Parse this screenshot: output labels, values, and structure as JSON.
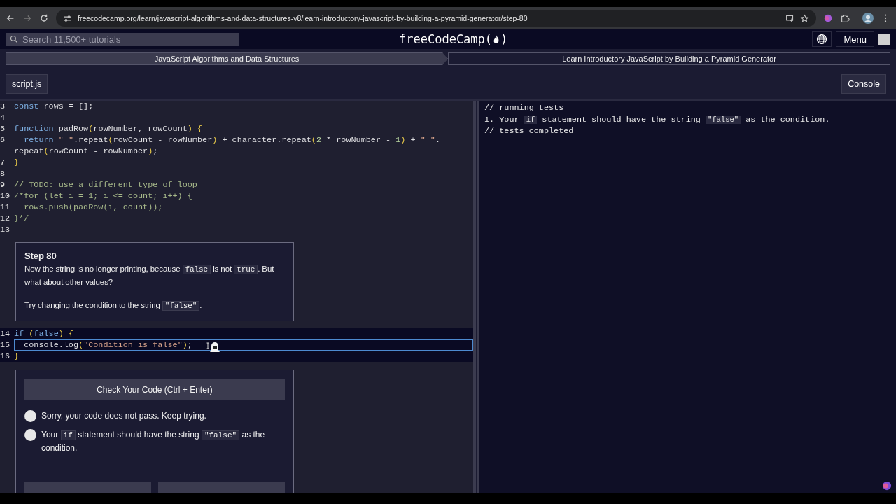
{
  "browser": {
    "url": "freecodecamp.org/learn/javascript-algorithms-and-data-structures-v8/learn-introductory-javascript-by-building-a-pyramid-generator/step-80"
  },
  "nav": {
    "search": {
      "placeholder": "Search 11,500+ tutorials"
    },
    "logo_before": "freeCodeCamp(",
    "logo_after": ")",
    "menu": "Menu"
  },
  "breadcrumbs": [
    {
      "label": "JavaScript Algorithms and Data Structures",
      "selected": true
    },
    {
      "label": "Learn Introductory JavaScript by Building a Pyramid Generator",
      "selected": false
    }
  ],
  "tabs": {
    "editor": "script.js",
    "console": "Console"
  },
  "code_upper": [
    {
      "number": "3",
      "tokens": [
        {
          "kind": "kw",
          "text": "const"
        },
        {
          "kind": "id",
          "text": " rows = [];"
        }
      ]
    },
    {
      "number": "4"
    },
    {
      "number": "5",
      "tokens": [
        {
          "kind": "kw",
          "text": "function"
        },
        {
          "kind": "id",
          "text": " padRow"
        },
        {
          "kind": "br",
          "text": "("
        },
        {
          "kind": "id",
          "text": "rowNumber, rowCount"
        },
        {
          "kind": "br",
          "text": ") {"
        }
      ]
    },
    {
      "number": "6",
      "tokens": [
        {
          "kind": "kw",
          "text": "  return "
        },
        {
          "kind": "str",
          "text": "\" \""
        },
        {
          "kind": "id",
          "text": ".repeat"
        },
        {
          "kind": "br",
          "text": "("
        },
        {
          "kind": "id",
          "text": "rowCount - rowNumber"
        },
        {
          "kind": "br",
          "text": ")"
        },
        {
          "kind": "id",
          "text": " + character.repeat"
        },
        {
          "kind": "br",
          "text": "("
        },
        {
          "kind": "num",
          "text": "2"
        },
        {
          "kind": "id",
          "text": " * rowNumber - "
        },
        {
          "kind": "num",
          "text": "1"
        },
        {
          "kind": "br",
          "text": ")"
        },
        {
          "kind": "id",
          "text": " + "
        },
        {
          "kind": "str",
          "text": "\" \""
        },
        {
          "kind": "id",
          "text": "."
        }
      ]
    },
    {
      "tokens": [
        {
          "kind": "id",
          "text": "repeat"
        },
        {
          "kind": "br",
          "text": "("
        },
        {
          "kind": "id",
          "text": "rowCount - rowNumber"
        },
        {
          "kind": "br",
          "text": ")"
        },
        {
          "kind": "id",
          "text": ";"
        }
      ]
    },
    {
      "number": "7",
      "tokens": [
        {
          "kind": "br",
          "text": "}"
        }
      ]
    },
    {
      "number": "8"
    },
    {
      "number": "9",
      "tokens": [
        {
          "kind": "com",
          "text": "// TODO: use a different type of loop"
        }
      ]
    },
    {
      "number": "10",
      "tokens": [
        {
          "kind": "com",
          "text": "/*for (let i = 1; i <= count; i++) {"
        }
      ]
    },
    {
      "number": "11",
      "tokens": [
        {
          "kind": "com",
          "text": "  rows.push(padRow(i, count));"
        }
      ]
    },
    {
      "number": "12",
      "tokens": [
        {
          "kind": "com",
          "text": "}*/"
        }
      ]
    },
    {
      "number": "13"
    }
  ],
  "step": {
    "title": "Step 80",
    "paragraphs": [
      [
        {
          "kind": "text",
          "text": "Now the string is no longer printing, because "
        },
        {
          "kind": "code",
          "text": "false"
        },
        {
          "kind": "text",
          "text": " is not "
        },
        {
          "kind": "code",
          "text": "true"
        },
        {
          "kind": "text",
          "text": ". But what about other values?"
        }
      ],
      [
        {
          "kind": "text",
          "text": "Try changing the condition to the string "
        },
        {
          "kind": "code",
          "text": "\"false\""
        },
        {
          "kind": "text",
          "text": "."
        }
      ]
    ]
  },
  "code_lower": [
    {
      "number": "14",
      "selected": false,
      "tokens": [
        {
          "kind": "kw",
          "text": "if "
        },
        {
          "kind": "br",
          "text": "("
        },
        {
          "kind": "kw",
          "text": "false"
        },
        {
          "kind": "br",
          "text": ") {"
        }
      ]
    },
    {
      "number": "15",
      "selected": true,
      "tokens": [
        {
          "kind": "id",
          "text": "  console.log"
        },
        {
          "kind": "br",
          "text": "("
        },
        {
          "kind": "str",
          "text": "\"Condition is false\""
        },
        {
          "kind": "br",
          "text": ")"
        },
        {
          "kind": "id",
          "text": ";"
        }
      ]
    },
    {
      "number": "16",
      "selected": false,
      "tokens": [
        {
          "kind": "br",
          "text": "}"
        }
      ]
    }
  ],
  "check_button": "Check Your Code (Ctrl + Enter)",
  "results": [
    [
      {
        "kind": "text",
        "text": "Sorry, your code does not pass. Keep trying."
      }
    ],
    [
      {
        "kind": "text",
        "text": "Your "
      },
      {
        "kind": "code",
        "text": "if"
      },
      {
        "kind": "text",
        "text": " statement should have the string "
      },
      {
        "kind": "code",
        "text": "\"false\""
      },
      {
        "kind": "text",
        "text": " as the condition."
      }
    ]
  ],
  "console": [
    [
      {
        "kind": "text",
        "text": "// running tests"
      }
    ],
    [
      {
        "kind": "text",
        "text": "1. Your "
      },
      {
        "kind": "code",
        "text": "if"
      },
      {
        "kind": "text",
        "text": " statement should have the string "
      },
      {
        "kind": "code",
        "text": "\"false\""
      },
      {
        "kind": "text",
        "text": " as the condition."
      }
    ],
    [
      {
        "kind": "text",
        "text": "// tests completed"
      }
    ]
  ]
}
